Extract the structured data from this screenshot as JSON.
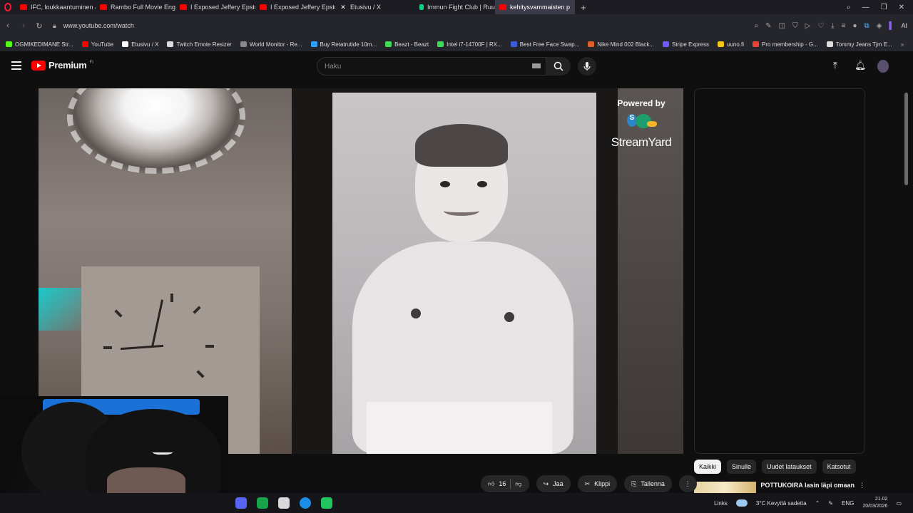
{
  "browser": {
    "tabs": [
      {
        "label": "IFC, loukkaantuminen & V",
        "favicon": "yt"
      },
      {
        "label": "Rambo Full Movie English",
        "favicon": "yt"
      },
      {
        "label": "I Exposed Jeffery Epstein's",
        "favicon": "yt"
      },
      {
        "label": "I Exposed Jeffery Epstein's",
        "favicon": "yt"
      },
      {
        "label": "Etusivu / X",
        "favicon": "x"
      },
      {
        "label": "Immun Fight Club | Ruutu",
        "favicon": "ruutu"
      },
      {
        "label": "kehitysvammaisten p",
        "favicon": "yt",
        "active": true
      }
    ],
    "new_tab": "+",
    "url": "www.youtube.com/watch",
    "ai_label": "AI",
    "bookmarks": [
      {
        "label": "OGMIKEDIMANE Str...",
        "color": "#53fc18"
      },
      {
        "label": "YouTube",
        "color": "#ff0000"
      },
      {
        "label": "Etusivu / X",
        "color": "#ffffff"
      },
      {
        "label": "Twitch Emote Resizer",
        "color": "#dddddd"
      },
      {
        "label": "World Monitor - Re...",
        "color": "#888888"
      },
      {
        "label": "Buy Retatrutide 10m...",
        "color": "#2aa1ff"
      },
      {
        "label": "Beazt - Beazt",
        "color": "#3ddc54"
      },
      {
        "label": "Intel i7-14700F | RX...",
        "color": "#3ddc54"
      },
      {
        "label": "Best Free Face Swap...",
        "color": "#3b5bdb"
      },
      {
        "label": "Nike Mind 002 Black...",
        "color": "#e0602a"
      },
      {
        "label": "Stripe Express",
        "color": "#6b5bff"
      },
      {
        "label": "uuno.fi",
        "color": "#f5c518"
      },
      {
        "label": "Pro membership - G...",
        "color": "#ea4335"
      },
      {
        "label": "Tommy Jeans Tjm E...",
        "color": "#dddddd"
      }
    ],
    "bookmarks_more": "»"
  },
  "youtube": {
    "logo": "Premium",
    "country": "FI",
    "search_placeholder": "Haku",
    "video_overlay": {
      "powered_by": "Powered by",
      "brand": "StreamYard"
    },
    "chips": [
      {
        "label": "Kaikki",
        "active": true
      },
      {
        "label": "Sinulle"
      },
      {
        "label": "Uudet lataukset"
      },
      {
        "label": "Katsotut"
      }
    ],
    "recommendation": {
      "title": "POTTUKOIRA lasin läpi omaan"
    },
    "actions": {
      "likes": "16",
      "share": "Jaa",
      "clip": "Klippi",
      "save": "Tallenna",
      "more": "⋮"
    }
  },
  "taskbar": {
    "links": "Links",
    "weather": "3°C  Kevyttä sadetta",
    "lang": "ENG",
    "time": "21.02",
    "date": "20/03/2026"
  }
}
